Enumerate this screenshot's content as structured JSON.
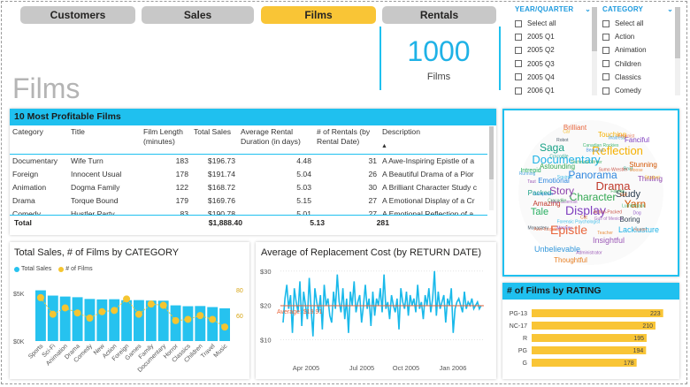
{
  "tabs": [
    {
      "label": "Customers",
      "active": false
    },
    {
      "label": "Sales",
      "active": false
    },
    {
      "label": "Films",
      "active": true
    },
    {
      "label": "Rentals",
      "active": false
    }
  ],
  "page_title": "Films",
  "kpi": {
    "value": "1000",
    "label": "Films"
  },
  "slicers": {
    "year_quarter": {
      "title": "YEAR/QUARTER",
      "items": [
        "Select all",
        "2005 Q1",
        "2005 Q2",
        "2005 Q3",
        "2005 Q4",
        "2006 Q1"
      ]
    },
    "category": {
      "title": "CATEGORY",
      "items": [
        "Select all",
        "Action",
        "Animation",
        "Children",
        "Classics",
        "Comedy"
      ]
    }
  },
  "top_films": {
    "title": "10 Most Profitable Films",
    "columns": [
      "Category",
      "Title",
      "Film Length (minutes)",
      "Total Sales",
      "Average Rental Duration (in days)",
      "# of Rentals (by Rental Date)",
      "Description"
    ],
    "rows": [
      [
        "Documentary",
        "Wife Turn",
        "183",
        "$196.73",
        "4.48",
        "31",
        "A Awe-Inspiring Epistle of a"
      ],
      [
        "Foreign",
        "Innocent Usual",
        "178",
        "$191.74",
        "5.04",
        "26",
        "A Beautiful Drama of a Pior"
      ],
      [
        "Animation",
        "Dogma Family",
        "122",
        "$168.72",
        "5.03",
        "30",
        "A Brilliant Character Study c"
      ],
      [
        "Drama",
        "Torque Bound",
        "179",
        "$169.76",
        "5.15",
        "27",
        "A Emotional Display of a Cr"
      ],
      [
        "Comedy",
        "Hustler Party",
        "83",
        "$190.78",
        "5.01",
        "27",
        "A Emotional Reflection of a"
      ]
    ],
    "total": {
      "label": "Total",
      "sales": "$1,888.40",
      "duration": "5.13",
      "rentals": "281"
    }
  },
  "word_cloud": {
    "words": [
      "Documentary",
      "Reflection",
      "Display",
      "Character",
      "Epistle",
      "Panorama",
      "Drama",
      "Story",
      "Saga",
      "Yarn",
      "Study",
      "Tale",
      "Insightful",
      "Unbelievable",
      "Thoughtful",
      "Lacklusture",
      "Touching",
      "Fanciful",
      "Astounding",
      "Brilliant",
      "Emotional",
      "Amazing",
      "Thrilling",
      "Packed",
      "Stunning",
      "Boring",
      "Intrepid",
      "Fateful",
      "Awe-Inspiring",
      "Beautiful",
      "Action-Packed",
      "Taut",
      "Boat",
      "Cat",
      "Robot",
      "Lumberjack",
      "Mad Scientist",
      "Waitress",
      "Teacher",
      "Squirrel",
      "Student",
      "Monkey",
      "Technical Writer",
      "Hunter",
      "Composer",
      "Sumo Wrestler",
      "Administrator",
      "Crocodile",
      "Girl",
      "Monastery",
      "Canadian Rockies",
      "Gulf of Mexico",
      "Running",
      "Moose",
      "Forensic Psychologist",
      "Car",
      "Dog",
      "Crocodile",
      "Feminist"
    ]
  },
  "category_chart": {
    "title": "Total Sales, # of Films by CATEGORY",
    "legend": [
      "Total Sales",
      "# of Films"
    ],
    "chart_data": {
      "type": "bar",
      "categories": [
        "Sports",
        "Sci-Fi",
        "Animation",
        "Drama",
        "Comedy",
        "New",
        "Action",
        "Foreign",
        "Games",
        "Family",
        "Documentary",
        "Horror",
        "Classics",
        "Children",
        "Travel",
        "Music"
      ],
      "series": [
        {
          "name": "Total Sales",
          "values": [
            5300,
            4750,
            4650,
            4580,
            4400,
            4350,
            4370,
            4270,
            4280,
            4230,
            4220,
            3730,
            3640,
            3660,
            3550,
            3420
          ]
        },
        {
          "name": "# of Films",
          "values": [
            74,
            61,
            66,
            62,
            58,
            63,
            64,
            73,
            61,
            69,
            68,
            56,
            57,
            60,
            57,
            51
          ]
        }
      ],
      "y_ticks": [
        "$5K",
        "$0K"
      ],
      "y2_ticks": [
        "80",
        "60"
      ],
      "ylim": [
        0,
        6000
      ],
      "y2lim": [
        40,
        85
      ]
    }
  },
  "replacement_chart": {
    "title": "Average of Replacement Cost (by RETURN DATE)",
    "average_label": "Average: $19.91",
    "chart_data": {
      "type": "line",
      "y_ticks": [
        "$30",
        "$20",
        "$10"
      ],
      "x_ticks": [
        "Apr 2005",
        "Jul 2005",
        "Oct 2005",
        "Jan 2006"
      ],
      "ylim": [
        5,
        32
      ],
      "average": 19.91,
      "values": [
        15,
        22,
        26,
        19,
        23,
        12,
        25,
        21,
        18,
        27,
        14,
        24,
        20,
        16,
        28,
        19,
        11,
        25,
        21,
        18,
        23,
        13,
        26,
        20,
        22,
        17,
        15,
        24,
        19,
        29,
        21,
        18,
        25,
        16,
        22,
        12,
        24,
        20,
        27,
        18,
        21,
        23,
        15,
        20,
        26,
        19,
        22,
        14,
        24,
        17,
        22,
        20,
        25,
        18,
        29,
        19,
        21,
        16,
        23,
        20,
        18,
        22,
        13,
        25,
        21,
        19,
        24,
        17,
        23,
        20,
        22,
        18,
        26,
        19,
        21,
        16,
        23,
        20,
        25,
        18,
        22,
        30,
        17,
        24,
        19,
        21,
        23,
        15,
        22,
        20,
        25,
        12,
        19,
        21,
        22,
        20,
        18,
        24,
        19,
        21,
        20,
        22,
        19,
        20,
        21,
        19,
        20
      ]
    }
  },
  "rating_chart": {
    "title": "# of Films by RATING",
    "chart_data": {
      "type": "bar",
      "categories": [
        "PG-13",
        "NC-17",
        "R",
        "PG",
        "G"
      ],
      "values": [
        223,
        210,
        195,
        194,
        178
      ],
      "xlim": [
        0,
        240
      ]
    }
  },
  "colors": {
    "accent": "#1fc0ef",
    "highlight": "#f9c536",
    "bar": "#26c2ef",
    "line": "#f5c530",
    "avg_line": "#e8663d"
  }
}
